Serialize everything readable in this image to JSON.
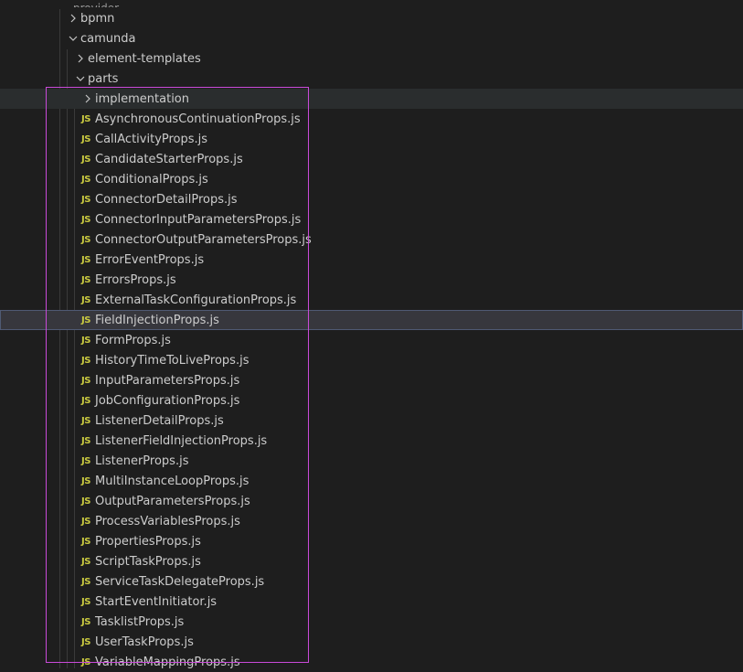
{
  "tree": {
    "top_cut": {
      "label": "provider"
    },
    "folders": {
      "bpmn": "bpmn",
      "camunda": "camunda",
      "element_templates": "element-templates",
      "parts": "parts",
      "implementation": "implementation"
    },
    "files": [
      "AsynchronousContinuationProps.js",
      "CallActivityProps.js",
      "CandidateStarterProps.js",
      "ConditionalProps.js",
      "ConnectorDetailProps.js",
      "ConnectorInputParametersProps.js",
      "ConnectorOutputParametersProps.js",
      "ErrorEventProps.js",
      "ErrorsProps.js",
      "ExternalTaskConfigurationProps.js",
      "FieldInjectionProps.js",
      "FormProps.js",
      "HistoryTimeToLiveProps.js",
      "InputParametersProps.js",
      "JobConfigurationProps.js",
      "ListenerDetailProps.js",
      "ListenerFieldInjectionProps.js",
      "ListenerProps.js",
      "MultiInstanceLoopProps.js",
      "OutputParametersProps.js",
      "ProcessVariablesProps.js",
      "PropertiesProps.js",
      "ScriptTaskProps.js",
      "ServiceTaskDelegateProps.js",
      "StartEventInitiator.js",
      "TasklistProps.js",
      "UserTaskProps.js",
      "VariableMappingProps.js"
    ],
    "file_icon_text": "JS",
    "selected_file": "FieldInjectionProps.js"
  },
  "colors": {
    "background": "#1e1e1e",
    "text": "#cccccc",
    "js_icon": "#cbcb41",
    "hover_row": "#2a2d2e",
    "selected_row": "#37373d",
    "annotation_box": "#c94ad9"
  }
}
